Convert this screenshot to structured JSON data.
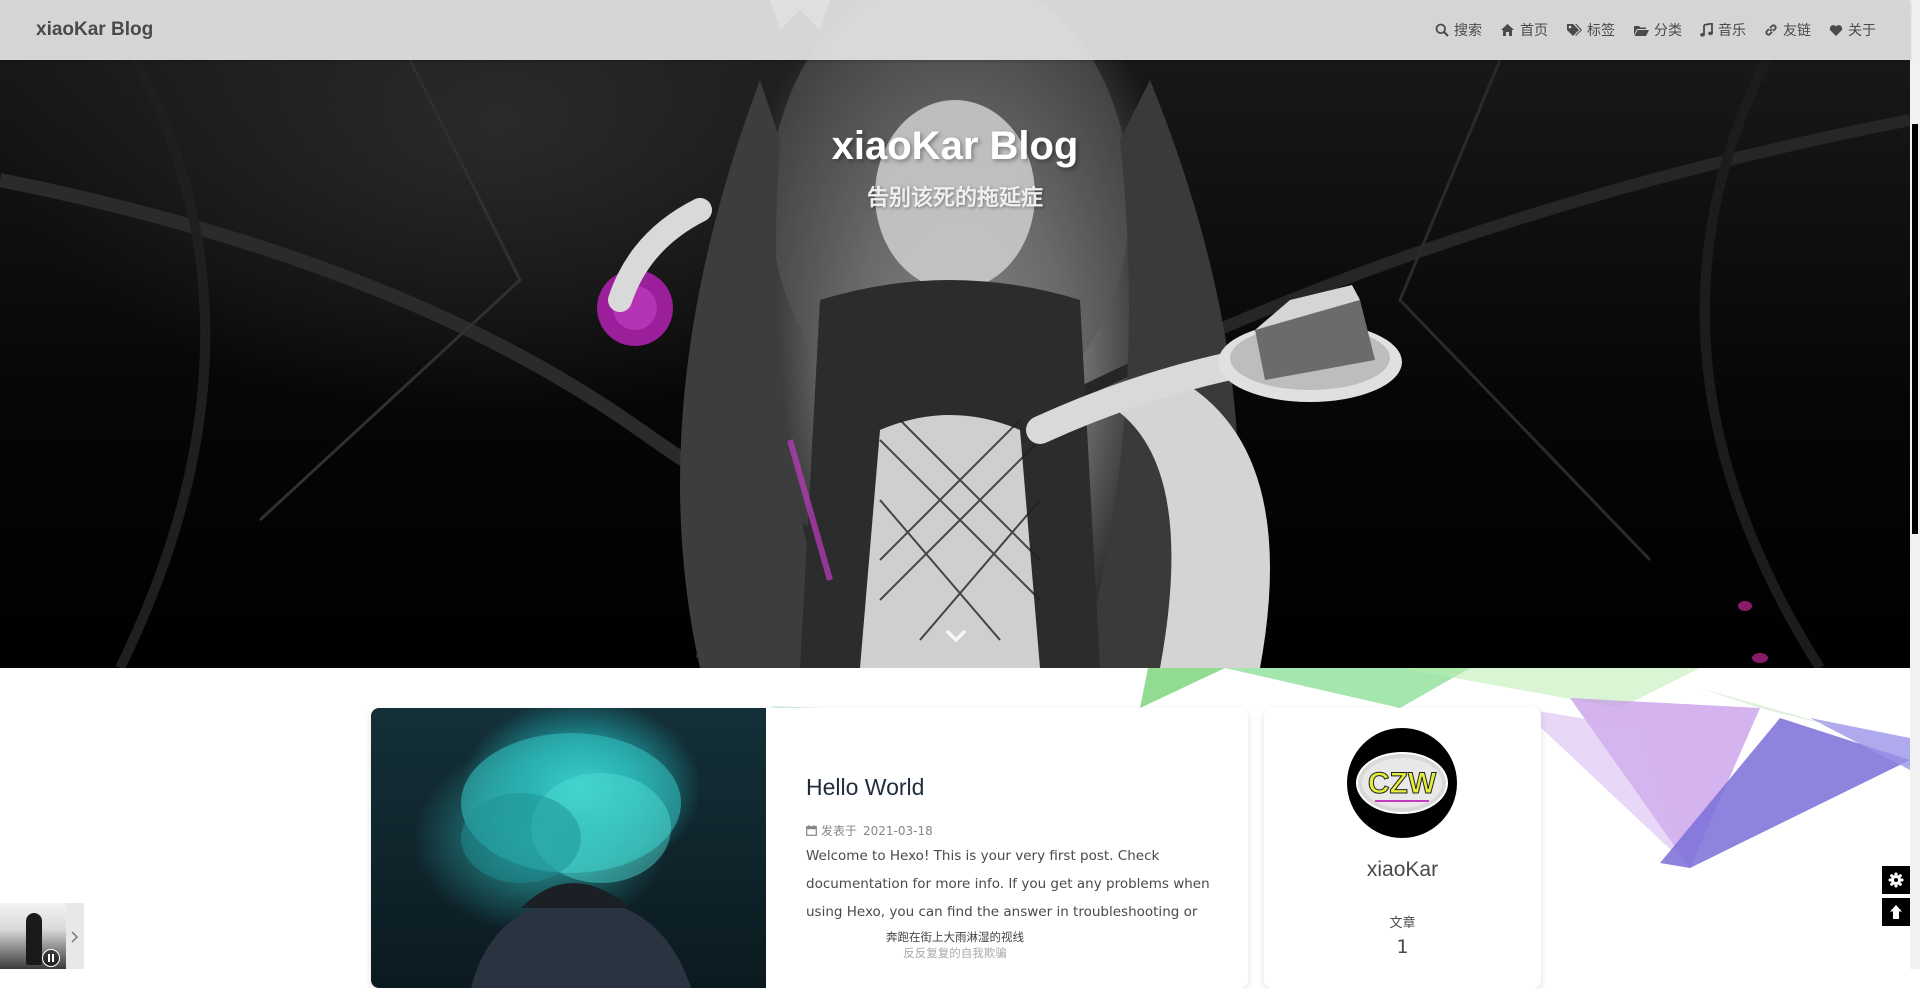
{
  "nav": {
    "brand": "xiaoKar Blog",
    "items": [
      {
        "icon": "search-icon",
        "label": "搜索"
      },
      {
        "icon": "home-icon",
        "label": "首页"
      },
      {
        "icon": "tags-icon",
        "label": "标签"
      },
      {
        "icon": "folder-icon",
        "label": "分类"
      },
      {
        "icon": "music-icon",
        "label": "音乐"
      },
      {
        "icon": "link-icon",
        "label": "友链"
      },
      {
        "icon": "heart-icon",
        "label": "关于"
      }
    ]
  },
  "hero": {
    "title": "xiaoKar Blog",
    "subtitle": "告别该死的拖延症"
  },
  "post": {
    "title": "Hello World",
    "meta_label": "发表于",
    "date": "2021-03-18",
    "excerpt": "Welcome to Hexo! This is your very first post. Check documentation for more info. If you get any problems when using Hexo, you can find the answer in troubleshooting or you..."
  },
  "author": {
    "avatar_text": "CZW",
    "name": "xiaoKar",
    "stat_label": "文章",
    "stat_value": "1"
  },
  "player": {
    "lyric_current": "奔跑在街上大雨淋湿的视线",
    "lyric_next": "反反复复的自我欺骗"
  },
  "colors": {
    "nav_bg": "#e4e4e4",
    "text": "#4c4948",
    "post_title": "#1f2d3d",
    "fab_bg": "#000000"
  }
}
